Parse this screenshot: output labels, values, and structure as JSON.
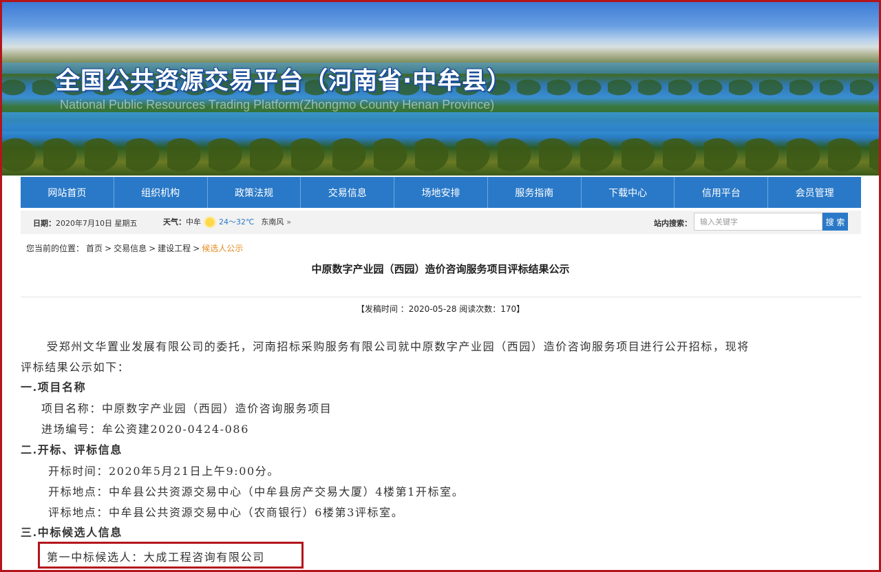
{
  "banner": {
    "title": "全国公共资源交易平台（河南省·中牟县）",
    "subtitle": "National Public Resources Trading Platform(Zhongmo County Henan Province)"
  },
  "nav": [
    "网站首页",
    "组织机构",
    "政策法规",
    "交易信息",
    "场地安排",
    "服务指南",
    "下载中心",
    "信用平台",
    "会员管理"
  ],
  "infobar": {
    "date_label": "日期：",
    "date_value": "2020年7月10日  星期五",
    "weather_label": "天气：",
    "city": "中牟",
    "weather_icon": "sun-icon",
    "temp": "24～32℃",
    "wind": "东南风",
    "wind_icon": "double-chevron-right-icon",
    "search_label": "站内搜索：",
    "search_placeholder": "输入关键字",
    "search_button": "搜 索"
  },
  "breadcrumb": {
    "prefix": "您当前的位置：",
    "items": [
      "首页",
      "交易信息",
      "建设工程",
      "候选人公示"
    ],
    "sep": ">"
  },
  "article": {
    "title": "中原数字产业园（西园）造价咨询服务项目评标结果公示",
    "meta": "【发稿时间 ：2020-05-28   阅读次数：170】",
    "intro_line1": "受郑州文华置业发展有限公司的委托，河南招标采购服务有限公司就中原数字产业园（西园）造价咨询服务项目进行公开招标，现将",
    "intro_line2": "评标结果公示如下：",
    "section1_heading": "一.项目名称",
    "project_name": "项目名称：中原数字产业园（西园）造价咨询服务项目",
    "project_code": "进场编号：牟公资建2020-0424-086",
    "section2_heading": "二.开标、评标信息",
    "open_time": "开标时间：2020年5月21日上午9:00分。",
    "open_place": "开标地点：中牟县公共资源交易中心（中牟县房产交易大厦）4楼第1开标室。",
    "eval_place": "评标地点：中牟县公共资源交易中心（农商银行）6楼第3评标室。",
    "section3_heading": "三.中标候选人信息",
    "first_candidate": "第一中标候选人：大成工程咨询有限公司"
  },
  "colors": {
    "nav_bg": "#2a79c8",
    "highlight_border": "#b3141b",
    "breadcrumb_current": "#e58a1e"
  }
}
